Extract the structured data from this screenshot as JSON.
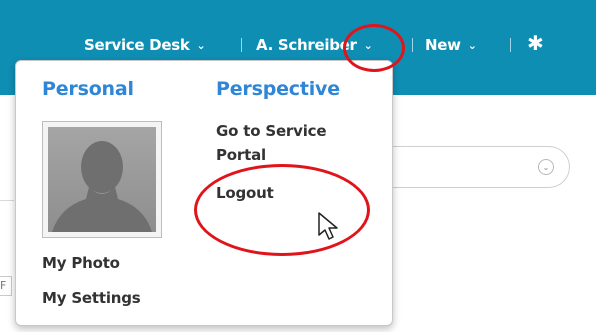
{
  "header": {
    "service_desk_label": "Service Desk",
    "user_label": "A. Schreiber",
    "new_label": "New",
    "chevron_glyph": "⌄",
    "gear_glyph": "✱",
    "background_color": "#0f8eb4"
  },
  "dropdown": {
    "personal": {
      "title": "Personal",
      "links": [
        "My Photo",
        "My Settings"
      ]
    },
    "perspective": {
      "title": "Perspective",
      "links": [
        "Go to Service\nPortal",
        "Logout"
      ]
    },
    "title_color": "#2f86d6"
  },
  "background": {
    "select_chevron_glyph": "⌄",
    "side_fragment": "F"
  },
  "annotation": {
    "circle_color": "#e0141b"
  }
}
